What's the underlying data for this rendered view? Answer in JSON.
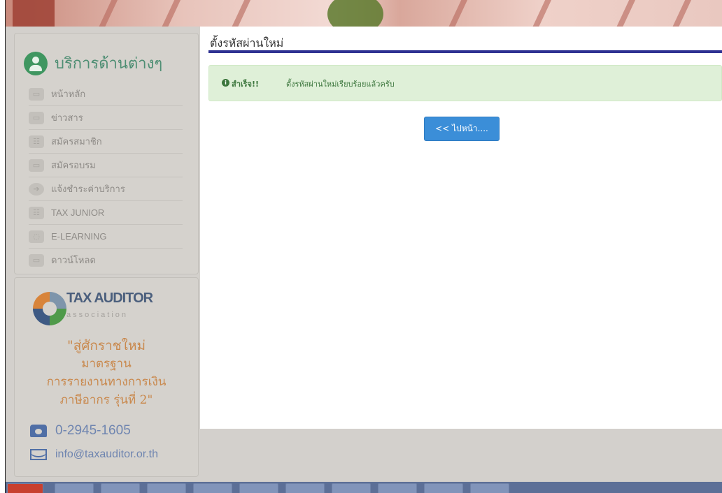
{
  "sidebar": {
    "title": "บริการด้านต่างๆ",
    "items": [
      {
        "label": "หน้าหลัก",
        "icon": "home-icon"
      },
      {
        "label": "ข่าวสาร",
        "icon": "news-icon"
      },
      {
        "label": "สมัครสมาชิก",
        "icon": "member-icon"
      },
      {
        "label": "สมัครอบรม",
        "icon": "training-icon"
      },
      {
        "label": "แจ้งชำระค่าบริการ",
        "icon": "payment-icon"
      },
      {
        "label": "TAX JUNIOR",
        "icon": "group-icon"
      },
      {
        "label": "E-LEARNING",
        "icon": "headset-icon"
      },
      {
        "label": "ดาวน์โหลด",
        "icon": "download-icon"
      }
    ]
  },
  "promo": {
    "logo_text": "TAX AUDITOR",
    "logo_sub": "association",
    "line1": "\"สู่ศักราชใหม่",
    "line2": "มาตรฐาน",
    "line3": "การรายงานทางการเงิน",
    "line4": "ภาษีอากร รุ่นที่ 2\"",
    "phone": "0-2945-1605",
    "email": "info@taxauditor.or.th"
  },
  "content": {
    "title": "ตั้งรหัสผ่านใหม่",
    "alert_strong": "สำเร็จ!!",
    "alert_message": "ตั้งรหัสผ่านใหม่เรียบร้อยแล้วครับ",
    "next_button": "<< ไปหน้า...."
  },
  "colors": {
    "accent_rule": "#2e3192",
    "success_bg": "#dff0d8",
    "button": "#3b8ed8"
  }
}
